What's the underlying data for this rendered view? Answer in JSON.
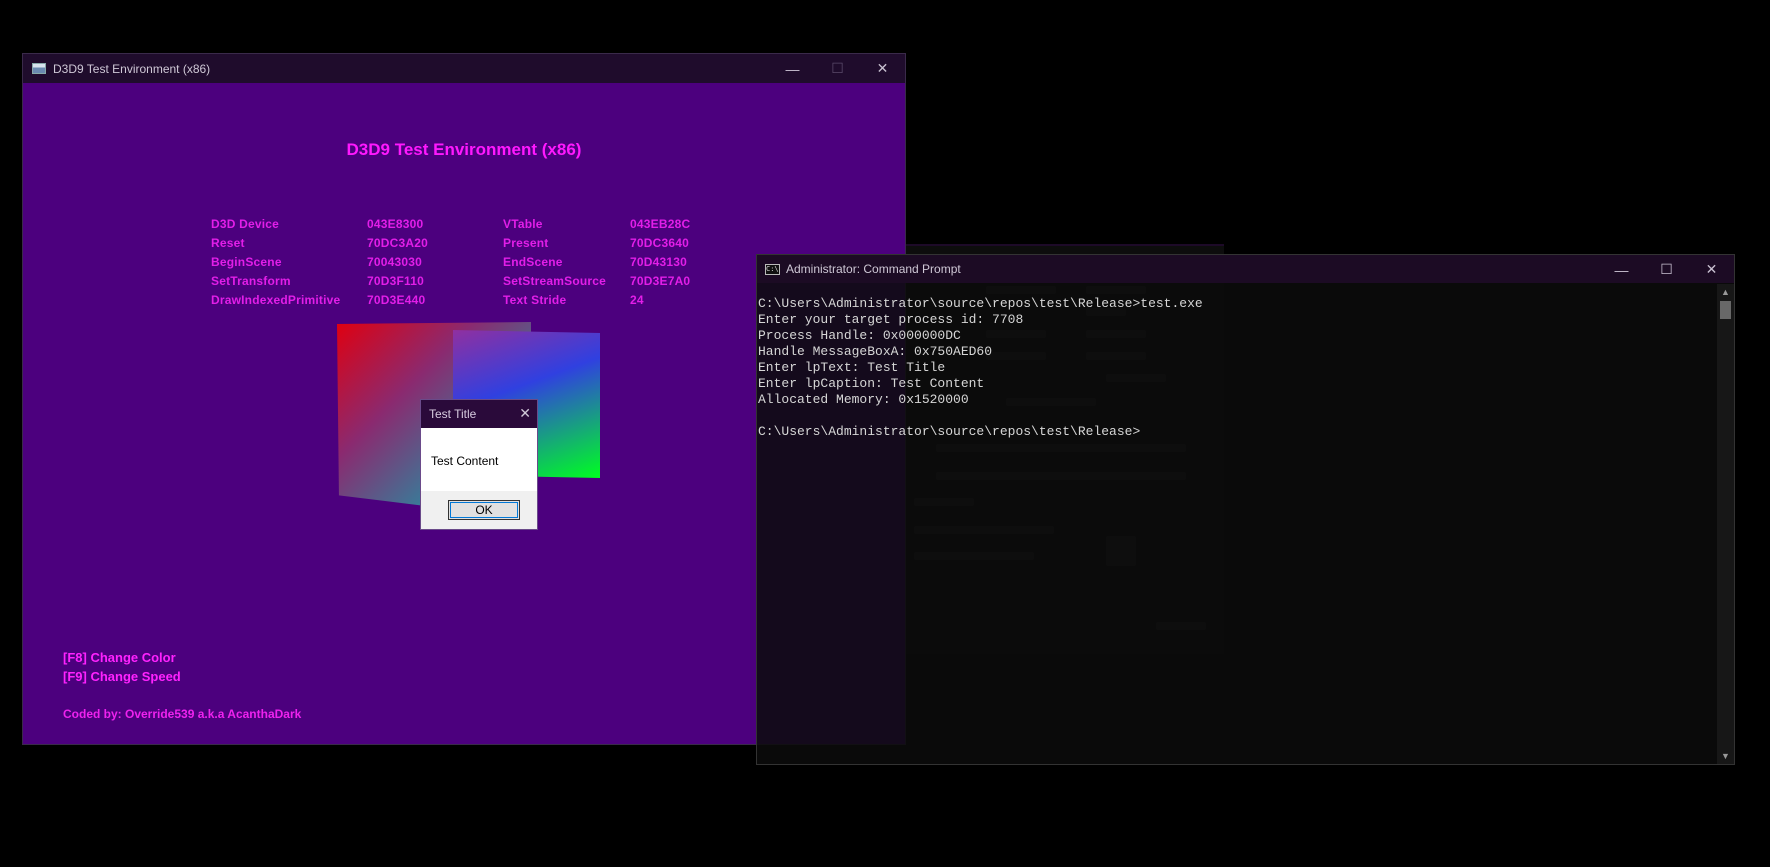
{
  "d3d_window": {
    "title": "D3D9 Test Environment (x86)",
    "heading": "D3D9 Test Environment (x86)",
    "info_rows": [
      {
        "label1": "D3D Device",
        "value1": "043E8300",
        "label2": "VTable",
        "value2": "043EB28C"
      },
      {
        "label1": "Reset",
        "value1": "70DC3A20",
        "label2": "Present",
        "value2": "70DC3640"
      },
      {
        "label1": "BeginScene",
        "value1": "70043030",
        "label2": "EndScene",
        "value2": "70D43130"
      },
      {
        "label1": "SetTransform",
        "value1": "70D3F110",
        "label2": "SetStreamSource",
        "value2": "70D3E7A0"
      },
      {
        "label1": "DrawIndexedPrimitive",
        "value1": "70D3E440",
        "label2": "Text Stride",
        "value2": "24"
      }
    ],
    "hotkeys": [
      "[F8] Change Color",
      "[F9] Change Speed"
    ],
    "credit": "Coded by: Override539 a.k.a AcanthaDark",
    "controls": {
      "minimize": "—",
      "maximize": "☐",
      "close": "✕"
    }
  },
  "message_box": {
    "title": "Test Title",
    "content": "Test Content",
    "ok_label": "OK",
    "close": "✕"
  },
  "cmd_window": {
    "title": "Administrator: Command Prompt",
    "icon_text": "C:\\",
    "controls": {
      "minimize": "—",
      "maximize": "☐",
      "close": "✕"
    },
    "lines": [
      "C:\\Users\\Administrator\\source\\repos\\test\\Release>test.exe",
      "Enter your target process id: 7708",
      "Process Handle: 0x000000DC",
      "Handle MessageBoxA: 0x750AED60",
      "Enter lpText: Test Title",
      "Enter lpCaption: Test Content",
      "Allocated Memory: 0x1520000",
      "",
      "C:\\Users\\Administrator\\source\\repos\\test\\Release>"
    ],
    "scroll_up": "▲",
    "scroll_down": "▼"
  },
  "colors": {
    "d3d_background": "#4c007e",
    "d3d_text": "#ff18ff",
    "console_text": "#d6d6d6"
  }
}
